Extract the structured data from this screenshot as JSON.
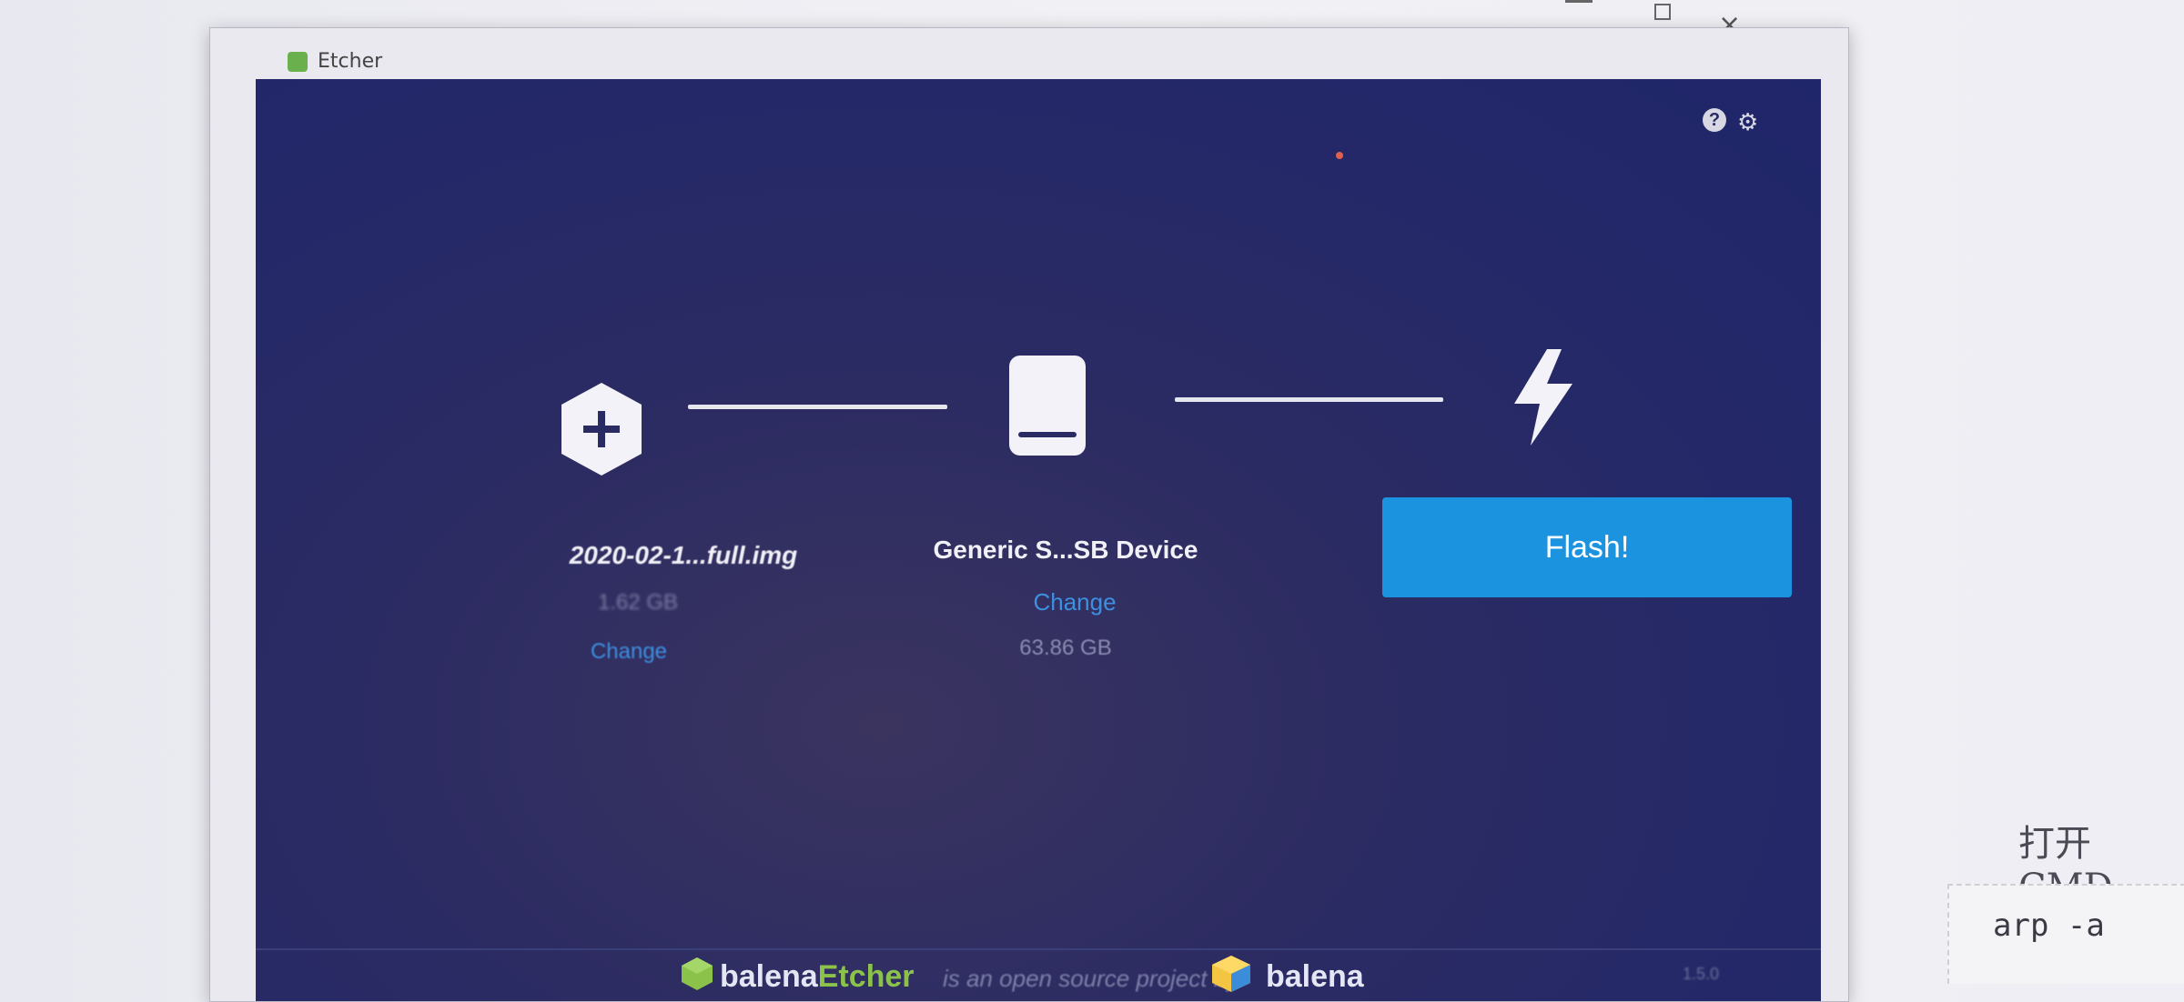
{
  "background": {
    "top_text": "",
    "side_text": "打开CMD",
    "code_snippet": "arp -a"
  },
  "window": {
    "title": "Etcher",
    "help_icon": "help-icon",
    "settings_icon": "gear-icon"
  },
  "steps": {
    "image": {
      "icon": "plus-hexagon-icon",
      "name": "2020-02-1...full.img",
      "size": "1.62 GB",
      "change_label": "Change"
    },
    "drive": {
      "icon": "drive-icon",
      "name": "Generic S...SB Device",
      "change_label": "Change",
      "size": "63.86 GB"
    },
    "flash": {
      "icon": "lightning-icon",
      "button_label": "Flash!"
    }
  },
  "footer": {
    "etcher_brand_1": "balena",
    "etcher_brand_2": "Etcher",
    "middle_text": "is an open source project by",
    "balena_brand": "balena",
    "version": "1.5.0"
  },
  "colors": {
    "app_background": "#2b2b63",
    "accent": "#1c93de",
    "link": "#3d8fe0"
  }
}
